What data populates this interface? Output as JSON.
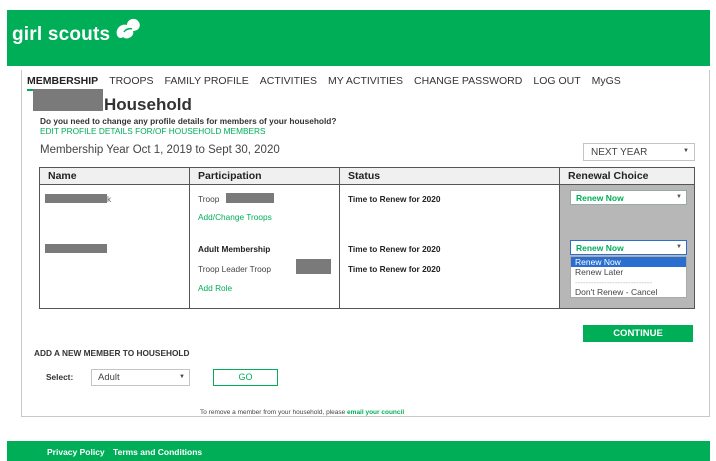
{
  "brand": {
    "name": "girl scouts",
    "color": "#00ae58"
  },
  "nav": {
    "items": [
      "MEMBERSHIP",
      "TROOPS",
      "FAMILY PROFILE",
      "ACTIVITIES",
      "MY ACTIVITIES",
      "CHANGE PASSWORD",
      "LOG OUT",
      "MyGS"
    ],
    "active": "MEMBERSHIP"
  },
  "household": {
    "title": "Household",
    "question": "Do you need to change any profile details for members of your household?",
    "edit_link": "EDIT PROFILE DETAILS FOR/OF HOUSEHOLD MEMBERS"
  },
  "membership_year": {
    "label": "Membership Year Oct 1, 2019 to Sept 30, 2020",
    "selected": "NEXT YEAR"
  },
  "table": {
    "headers": [
      "Name",
      "Participation",
      "Status",
      "Renewal Choice"
    ],
    "rows": [
      {
        "name_suffix": "k",
        "participation": "Troop",
        "link": "Add/Change Troops",
        "status": "Time to Renew for 2020",
        "choice": "Renew Now"
      },
      {
        "participation": "Adult Membership",
        "participation2": "Troop Leader Troop",
        "link": "Add Role",
        "status": "Time to Renew for 2020",
        "status2": "Time to Renew for 2020",
        "choice": "Renew Now"
      }
    ],
    "dropdown_options": [
      "Renew Now",
      "Renew Later",
      "-----------------------------",
      "Don't Renew - Cancel"
    ]
  },
  "continue_label": "CONTINUE",
  "add_member": {
    "title": "ADD A NEW MEMBER TO HOUSEHOLD",
    "select_label": "Select:",
    "selected": "Adult",
    "go_label": "GO"
  },
  "remove_note": {
    "text": "To remove a member from your household, please ",
    "link": "email your council"
  },
  "footer": {
    "privacy": "Privacy Policy",
    "terms": "Terms and Conditions"
  }
}
